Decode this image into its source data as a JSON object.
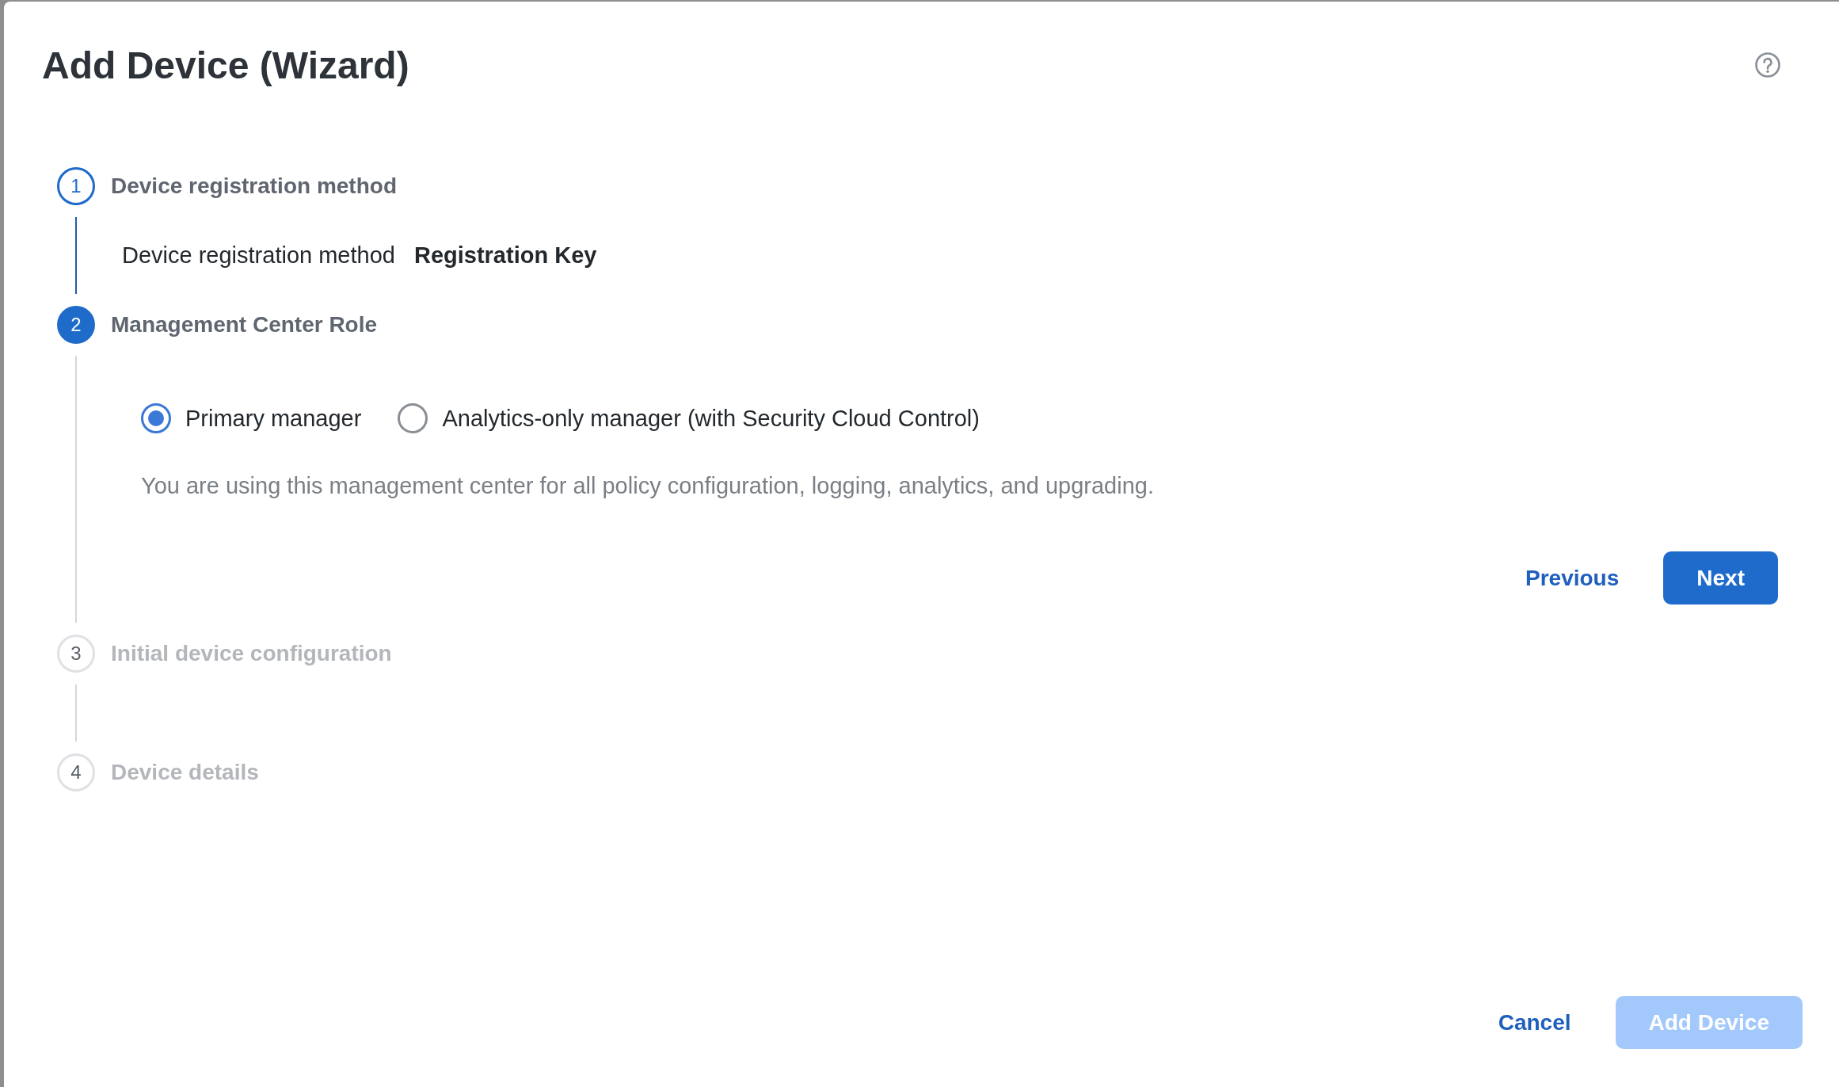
{
  "dialog": {
    "title": "Add Device (Wizard)"
  },
  "steps": [
    {
      "number": "1",
      "label": "Device registration method",
      "completed": true,
      "selected": false,
      "summary": {
        "label": "Device registration method",
        "value": "Registration Key"
      }
    },
    {
      "number": "2",
      "label": "Management Center Role",
      "completed": false,
      "selected": true,
      "options": [
        {
          "label": "Primary manager",
          "selected": true
        },
        {
          "label": "Analytics-only manager (with Security Cloud Control)",
          "selected": false
        }
      ],
      "description": "You are using this management center for all policy configuration, logging, analytics, and upgrading.",
      "buttons": [
        {
          "label": "Previous",
          "kind": "link"
        },
        {
          "label": "Next",
          "kind": "primary"
        }
      ]
    },
    {
      "number": "3",
      "label": "Initial device configuration",
      "completed": false,
      "selected": false
    },
    {
      "number": "4",
      "label": "Device details",
      "completed": false,
      "selected": false
    }
  ],
  "footer": {
    "buttons": [
      {
        "label": "Cancel",
        "kind": "link",
        "disabled": false
      },
      {
        "label": "Add Device",
        "kind": "primary",
        "disabled": true
      }
    ]
  }
}
